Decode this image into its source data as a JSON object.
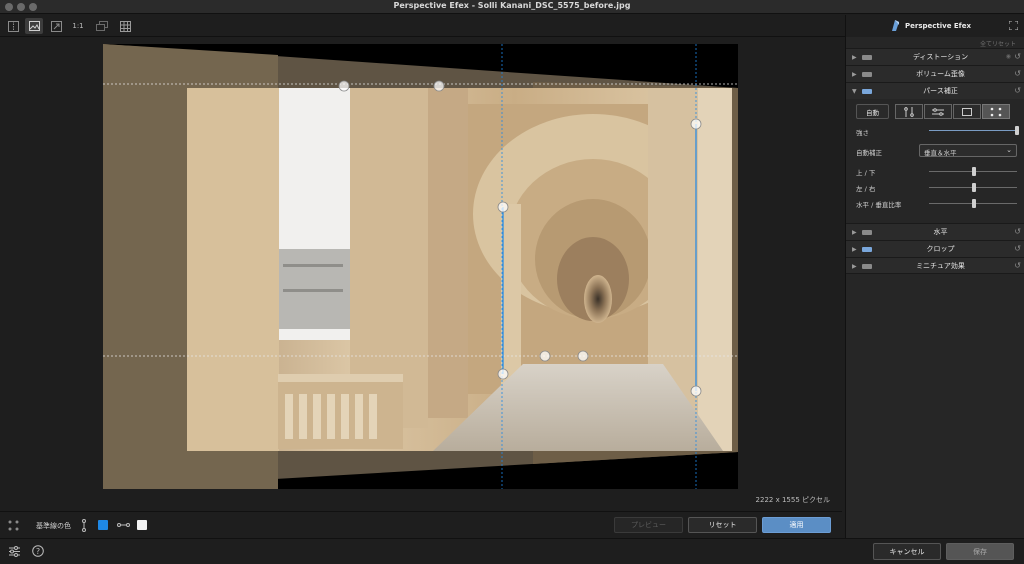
{
  "window": {
    "title": "Perspective Efex - Solli Kanani_DSC_5575_before.jpg"
  },
  "toolbar": {
    "zoom_1to1": "1:1"
  },
  "canvas": {
    "pixel_info": "2222 x 1555 ピクセル"
  },
  "options": {
    "reference_line_color_label": "基準線の色",
    "swatch_colors": [
      "#1e88e5",
      "#f2f2f2"
    ],
    "preview_label": "プレビュー",
    "reset_label": "リセット",
    "apply_label": "適用"
  },
  "panel": {
    "app_name": "Perspective Efex",
    "reset_all": "全てリセット",
    "sections": {
      "distortion": "ディストーション",
      "volume": "ボリューム歪像",
      "perspective": "パース補正",
      "horizon": "水平",
      "crop": "クロップ",
      "miniature": "ミニチュア効果"
    },
    "perspective": {
      "auto_button": "自動",
      "strength_label": "強さ",
      "strength_value": 1.0,
      "auto_correct_label": "自動補正",
      "auto_correct_value": "垂直＆水平",
      "up_down_label": "上 / 下",
      "up_down_value": 0.5,
      "left_right_label": "左 / 右",
      "left_right_value": 0.5,
      "ratio_label": "水平 / 垂直比率",
      "ratio_value": 0.5
    }
  },
  "footer": {
    "cancel_label": "キャンセル",
    "save_label": "保存"
  }
}
